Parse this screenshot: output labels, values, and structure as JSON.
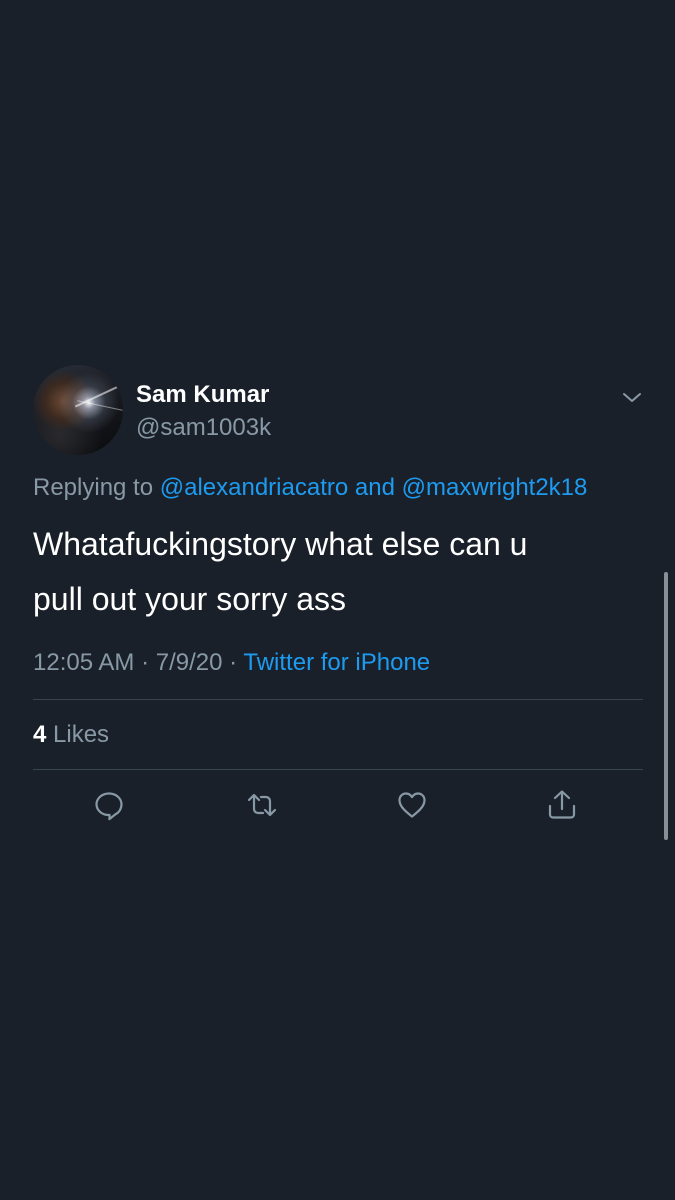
{
  "tweet": {
    "author": {
      "name": "Sam Kumar",
      "handle": "@sam1003k"
    },
    "reply": {
      "prefix": "Replying to",
      "user1": "@alexandriacatro",
      "joiner": "and",
      "user2": "@maxwright2k18"
    },
    "text_line1": "Whatafuckingstory what else can u",
    "text_line2": "pull out your sorry ass",
    "meta": {
      "time": "12:05 AM",
      "sep1": "·",
      "date": "7/9/20",
      "sep2": "·",
      "source": "Twitter for iPhone"
    },
    "stats": {
      "likes_count": "4",
      "likes_label": "Likes"
    },
    "actions": [
      "reply-icon",
      "retweet-icon",
      "like-icon",
      "share-icon"
    ]
  },
  "colors": {
    "background": "#1a202a",
    "link": "#1d9bf0",
    "secondary_text": "#8899a6",
    "divider": "#38444d"
  }
}
